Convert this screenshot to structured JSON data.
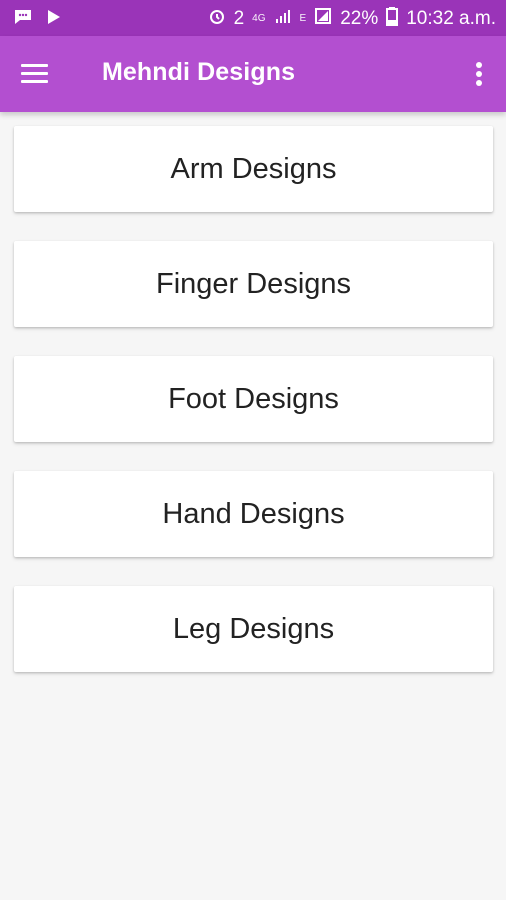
{
  "status_bar": {
    "left_icons": [
      "chat-icon",
      "play-store-icon"
    ],
    "alarm_icon": "alarm-icon",
    "sim_badge": "2",
    "network_type": "4G",
    "secondary_network": "E",
    "battery_percent": "22%",
    "time": "10:32 a.m."
  },
  "app_bar": {
    "menu_icon": "menu-icon",
    "title": "Mehndi Designs",
    "overflow_icon": "more-vert-icon"
  },
  "categories": [
    {
      "label": "Arm Designs"
    },
    {
      "label": "Finger Designs"
    },
    {
      "label": "Foot Designs"
    },
    {
      "label": "Hand Designs"
    },
    {
      "label": "Leg Designs"
    }
  ],
  "colors": {
    "status_bar": "#9a34b8",
    "app_bar": "#b34fd0",
    "background": "#f6f6f6",
    "card": "#ffffff",
    "text": "#222222"
  }
}
